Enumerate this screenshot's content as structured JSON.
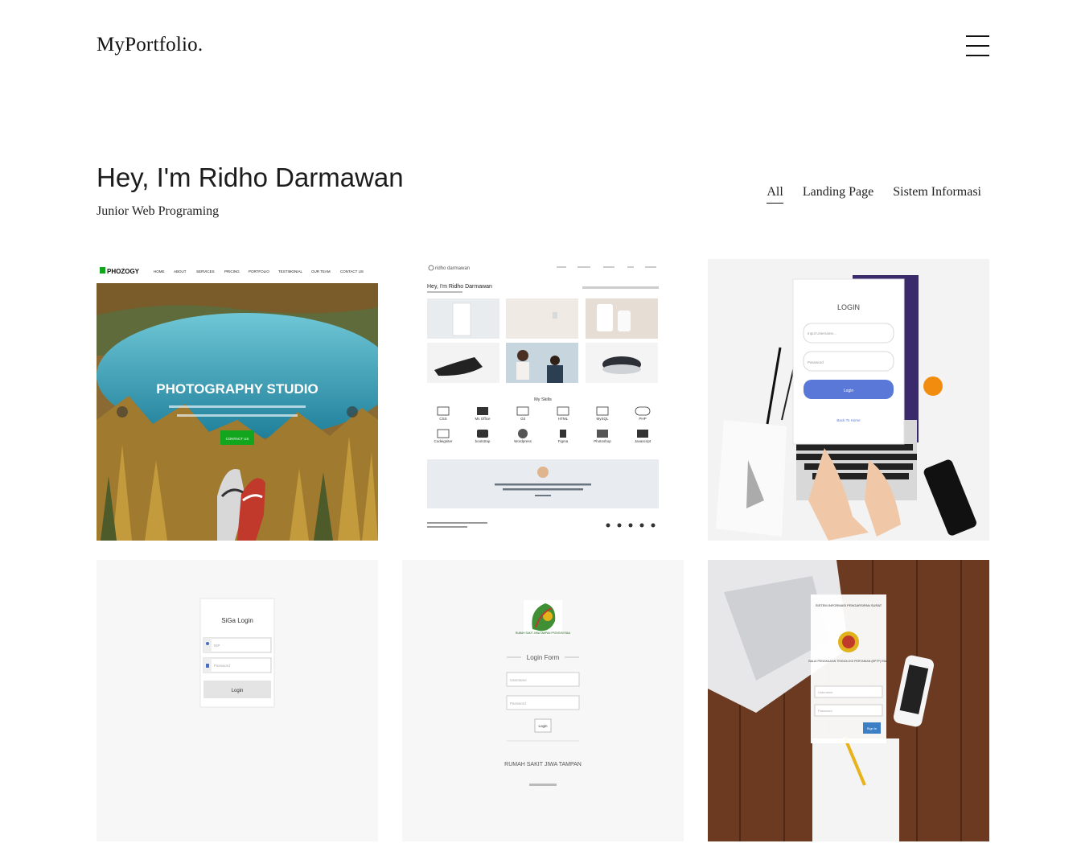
{
  "header": {
    "brand": "MyPortfolio."
  },
  "hero": {
    "title": "Hey, I'm Ridho Darmawan",
    "subtitle": "Junior Web Programing"
  },
  "filters": [
    "All",
    "Landing Page",
    "Sistem Informasi"
  ],
  "portfolio": [
    {
      "brand": "PHOZOGY",
      "nav": [
        "HOME",
        "ABOUT",
        "SERVICES",
        "PRICING",
        "PORTFOLIO",
        "TESTIMONIAL",
        "OUR TEAM",
        "CONTACT US"
      ],
      "headline": "PHOTOGRAPHY STUDIO",
      "button": "CONTACT US"
    },
    {
      "brand": "ridho darmawan",
      "heading": "Hey, I'm Ridho Darmawan",
      "skills_title": "My Skills",
      "skills": [
        "CSS",
        "Ms Office",
        "Git",
        "HTML",
        "MySQL",
        "PHP",
        "Codeigniter",
        "bootstrap",
        "Wordpress",
        "Figma",
        "Photoshop",
        "Javascript"
      ]
    },
    {
      "title": "LOGIN",
      "user_placeholder": "Input Username...",
      "pass_placeholder": "Password",
      "button": "Login",
      "link": "Back To Home"
    },
    {
      "title": "SiGa Login",
      "user_placeholder": "NIP",
      "pass_placeholder": "Password",
      "button": "Login"
    },
    {
      "logo_text": "RUMAH SAKIT JIWA TAMPAN PROVINSI RIAU",
      "title": "Login Form",
      "user_placeholder": "Username",
      "pass_placeholder": "Password",
      "button": "Login",
      "footer": "RUMAH SAKIT JIWA TAMPAN"
    },
    {
      "title": "SISTEM INFORMASI PENGARSIPAN SURAT",
      "org": "BALAI PENGKAJIAN TEKNOLOGI PERTANIAN (BPTP) RIAU",
      "user_placeholder": "Username",
      "pass_placeholder": "Password",
      "button": "Sign In"
    }
  ],
  "colors": {
    "accent_blue": "#5a78d8",
    "green_button": "#12a51e",
    "lake": "#3aa9c2",
    "wood": "#6b3a20"
  }
}
